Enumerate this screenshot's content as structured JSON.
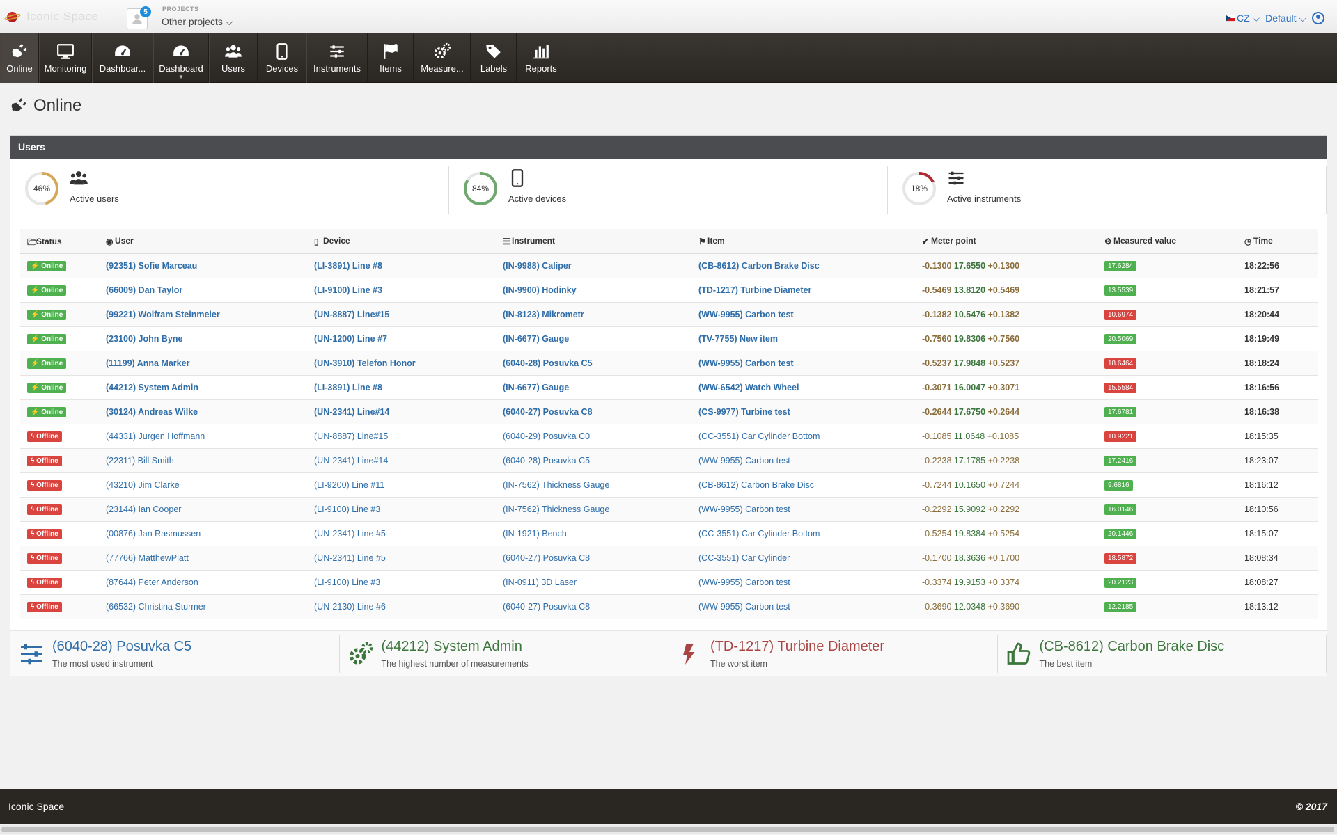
{
  "header": {
    "logo_text": "Iconic Space",
    "projects_badge": "5",
    "projects_label": "PROJECTS",
    "projects_select": "Other projects ⌵",
    "language": "CZ ⌵",
    "profile": "Default ⌵"
  },
  "nav": [
    {
      "label": "Online",
      "icon": "plug-icon"
    },
    {
      "label": "Monitoring",
      "icon": "monitor-icon"
    },
    {
      "label": "Dashboar...",
      "icon": "dashboard-icon"
    },
    {
      "label": "Dashboard",
      "icon": "dashboard-icon"
    },
    {
      "label": "Users",
      "icon": "users-icon"
    },
    {
      "label": "Devices",
      "icon": "tablet-icon"
    },
    {
      "label": "Instruments",
      "icon": "sliders-icon"
    },
    {
      "label": "Items",
      "icon": "flag-icon"
    },
    {
      "label": "Measure...",
      "icon": "cogs-icon"
    },
    {
      "label": "Labels",
      "icon": "tags-icon"
    },
    {
      "label": "Reports",
      "icon": "bar-chart-icon"
    }
  ],
  "page": {
    "title": "Online"
  },
  "panel": {
    "title": "Users"
  },
  "stats": [
    {
      "percent": "46%",
      "value": 46,
      "label": "Active users",
      "color": "#d4a857"
    },
    {
      "percent": "84%",
      "value": 84,
      "label": "Active devices",
      "color": "#6fa86f"
    },
    {
      "percent": "18%",
      "value": 18,
      "label": "Active instruments",
      "color": "#b3282d"
    }
  ],
  "table": {
    "headers": [
      "Status",
      "User",
      "Device",
      "Instrument",
      "Item",
      "Meter point",
      "Measured value",
      "Time"
    ],
    "rows": [
      {
        "status": "Online",
        "user": "(92351) Sofie Marceau",
        "device": "(LI-3891) Line #8",
        "instrument": "(IN-9988) Caliper",
        "item": "(CB-8612) Carbon Brake Disc",
        "lo": "-0.1300",
        "mid": "17.6550",
        "hi": "+0.1300",
        "value": "17.6284",
        "ok": true,
        "time": "18:22:56"
      },
      {
        "status": "Online",
        "user": "(66009) Dan Taylor",
        "device": "(LI-9100) Line #3",
        "instrument": "(IN-9900) Hodinky",
        "item": "(TD-1217) Turbine Diameter",
        "lo": "-0.5469",
        "mid": "13.8120",
        "hi": "+0.5469",
        "value": "13.5539",
        "ok": true,
        "time": "18:21:57"
      },
      {
        "status": "Online",
        "user": "(99221) Wolfram Steinmeier",
        "device": "(UN-8887) Line#15",
        "instrument": "(IN-8123) Mikrometr",
        "item": "(WW-9955) Carbon test",
        "lo": "-0.1382",
        "mid": "10.5476",
        "hi": "+0.1382",
        "value": "10.6974",
        "ok": false,
        "time": "18:20:44"
      },
      {
        "status": "Online",
        "user": "(23100) John Byne",
        "device": "(UN-1200) Line #7",
        "instrument": "(IN-6677) Gauge",
        "item": "(TV-7755) New item",
        "lo": "-0.7560",
        "mid": "19.8306",
        "hi": "+0.7560",
        "value": "20.5069",
        "ok": true,
        "time": "18:19:49"
      },
      {
        "status": "Online",
        "user": "(11199) Anna Marker",
        "device": "(UN-3910) Telefon Honor",
        "instrument": "(6040-28) Posuvka C5",
        "item": "(WW-9955) Carbon test",
        "lo": "-0.5237",
        "mid": "17.9848",
        "hi": "+0.5237",
        "value": "18.6464",
        "ok": false,
        "time": "18:18:24"
      },
      {
        "status": "Online",
        "user": "(44212) System Admin",
        "device": "(LI-3891) Line #8",
        "instrument": "(IN-6677) Gauge",
        "item": "(WW-6542) Watch Wheel",
        "lo": "-0.3071",
        "mid": "16.0047",
        "hi": "+0.3071",
        "value": "15.5584",
        "ok": false,
        "time": "18:16:56"
      },
      {
        "status": "Online",
        "user": "(30124) Andreas Wilke",
        "device": "(UN-2341) Line#14",
        "instrument": "(6040-27) Posuvka C8",
        "item": "(CS-9977) Turbine test",
        "lo": "-0.2644",
        "mid": "17.6750",
        "hi": "+0.2644",
        "value": "17.6781",
        "ok": true,
        "time": "18:16:38"
      },
      {
        "status": "Offline",
        "user": "(44331) Jurgen Hoffmann",
        "device": "(UN-8887) Line#15",
        "instrument": "(6040-29) Posuvka C0",
        "item": "(CC-3551) Car Cylinder Bottom",
        "lo": "-0.1085",
        "mid": "11.0648",
        "hi": "+0.1085",
        "value": "10.9221",
        "ok": false,
        "time": "18:15:35"
      },
      {
        "status": "Offline",
        "user": "(22311) Bill Smith",
        "device": "(UN-2341) Line#14",
        "instrument": "(6040-28) Posuvka C5",
        "item": "(WW-9955) Carbon test",
        "lo": "-0.2238",
        "mid": "17.1785",
        "hi": "+0.2238",
        "value": "17.2416",
        "ok": true,
        "time": "18:23:07"
      },
      {
        "status": "Offline",
        "user": "(43210) Jim Clarke",
        "device": "(LI-9200) Line #11",
        "instrument": "(IN-7562) Thickness Gauge",
        "item": "(CB-8612) Carbon Brake Disc",
        "lo": "-0.7244",
        "mid": "10.1650",
        "hi": "+0.7244",
        "value": "9.6816",
        "ok": true,
        "time": "18:16:12"
      },
      {
        "status": "Offline",
        "user": "(23144) Ian Cooper",
        "device": "(LI-9100) Line #3",
        "instrument": "(IN-7562) Thickness Gauge",
        "item": "(WW-9955) Carbon test",
        "lo": "-0.2292",
        "mid": "15.9092",
        "hi": "+0.2292",
        "value": "16.0146",
        "ok": true,
        "time": "18:10:56"
      },
      {
        "status": "Offline",
        "user": "(00876) Jan Rasmussen",
        "device": "(UN-2341) Line #5",
        "instrument": "(IN-1921) Bench",
        "item": "(CC-3551) Car Cylinder Bottom",
        "lo": "-0.5254",
        "mid": "19.8384",
        "hi": "+0.5254",
        "value": "20.1446",
        "ok": true,
        "time": "18:15:07"
      },
      {
        "status": "Offline",
        "user": "(77766) MatthewPlatt",
        "device": "(UN-2341) Line #5",
        "instrument": "(6040-27) Posuvka C8",
        "item": "(CC-3551) Car Cylinder",
        "lo": "-0.1700",
        "mid": "18.3636",
        "hi": "+0.1700",
        "value": "18.5872",
        "ok": false,
        "time": "18:08:34"
      },
      {
        "status": "Offline",
        "user": "(87644) Peter Anderson",
        "device": "(LI-9100) Line #3",
        "instrument": "(IN-0911) 3D Laser",
        "item": "(WW-9955) Carbon test",
        "lo": "-0.3374",
        "mid": "19.9153",
        "hi": "+0.3374",
        "value": "20.2123",
        "ok": true,
        "time": "18:08:27"
      },
      {
        "status": "Offline",
        "user": "(66532) Christina Sturmer",
        "device": "(UN-2130) Line #6",
        "instrument": "(6040-27) Posuvka C8",
        "item": "(WW-9955) Carbon test",
        "lo": "-0.3690",
        "mid": "12.0348",
        "hi": "+0.3690",
        "value": "12.2185",
        "ok": true,
        "time": "18:13:12"
      }
    ]
  },
  "summary": [
    {
      "title": "(6040-28) Posuvka C5",
      "subtitle": "The most used instrument",
      "color": "blue",
      "icon": "sliders-icon"
    },
    {
      "title": "(44212) System Admin",
      "subtitle": "The highest number of measurements",
      "color": "green",
      "icon": "cogs-icon"
    },
    {
      "title": "(TD-1217) Turbine Diameter",
      "subtitle": "The worst item",
      "color": "red",
      "icon": "bolt-icon"
    },
    {
      "title": "(CB-8612) Carbon Brake Disc",
      "subtitle": "The best item",
      "color": "green",
      "icon": "thumbs-up-icon"
    }
  ],
  "footer": {
    "left": "Iconic Space",
    "right": "© 2017"
  }
}
